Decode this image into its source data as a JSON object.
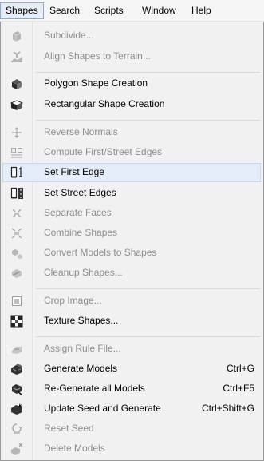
{
  "menubar": [
    {
      "label": "Shapes",
      "active": true
    },
    {
      "label": "Search"
    },
    {
      "label": "Scripts"
    },
    {
      "label": "Window"
    },
    {
      "label": "Help"
    }
  ],
  "menu": [
    {
      "label": "Subdivide...",
      "enabled": false,
      "icon": "subdivide-icon"
    },
    {
      "label": "Align Shapes to Terrain...",
      "enabled": false,
      "icon": "align-terrain-icon"
    },
    {
      "label": "Polygon Shape Creation",
      "enabled": true,
      "icon": "polygon-shape-icon"
    },
    {
      "label": "Rectangular Shape Creation",
      "enabled": true,
      "icon": "rectangle-shape-icon"
    },
    {
      "label": "Reverse Normals",
      "enabled": false,
      "icon": "reverse-normals-icon"
    },
    {
      "label": "Compute First/Street Edges",
      "enabled": false,
      "icon": "compute-edges-icon"
    },
    {
      "label": "Set First Edge",
      "enabled": true,
      "highlighted": true,
      "icon": "first-edge-icon"
    },
    {
      "label": "Set Street Edges",
      "enabled": true,
      "icon": "street-edges-icon"
    },
    {
      "label": "Separate Faces",
      "enabled": false,
      "icon": "separate-faces-icon"
    },
    {
      "label": "Combine Shapes",
      "enabled": false,
      "icon": "combine-shapes-icon"
    },
    {
      "label": "Convert Models to Shapes",
      "enabled": false,
      "icon": "convert-models-icon"
    },
    {
      "label": "Cleanup Shapes...",
      "enabled": false,
      "icon": "cleanup-shapes-icon"
    },
    {
      "label": "Crop Image...",
      "enabled": false,
      "icon": "crop-image-icon"
    },
    {
      "label": "Texture Shapes...",
      "enabled": true,
      "icon": "texture-shapes-icon"
    },
    {
      "label": "Assign Rule File...",
      "enabled": false,
      "icon": "assign-rule-icon"
    },
    {
      "label": "Generate Models",
      "enabled": true,
      "shortcut": "Ctrl+G",
      "icon": "generate-models-icon"
    },
    {
      "label": "Re-Generate all Models",
      "enabled": true,
      "shortcut": "Ctrl+F5",
      "icon": "regenerate-models-icon"
    },
    {
      "label": "Update Seed and Generate",
      "enabled": true,
      "shortcut": "Ctrl+Shift+G",
      "icon": "update-seed-icon"
    },
    {
      "label": "Reset Seed",
      "enabled": false,
      "icon": "reset-seed-icon"
    },
    {
      "label": "Delete Models",
      "enabled": false,
      "icon": "delete-models-icon"
    }
  ],
  "colors": {
    "menu_bg": "#f1f1f1",
    "disabled_text": "#8d8d8d",
    "highlight_bg": "#e4edf9",
    "highlight_border": "#c6d7ef",
    "active_menu_border": "#8fa7d3"
  }
}
